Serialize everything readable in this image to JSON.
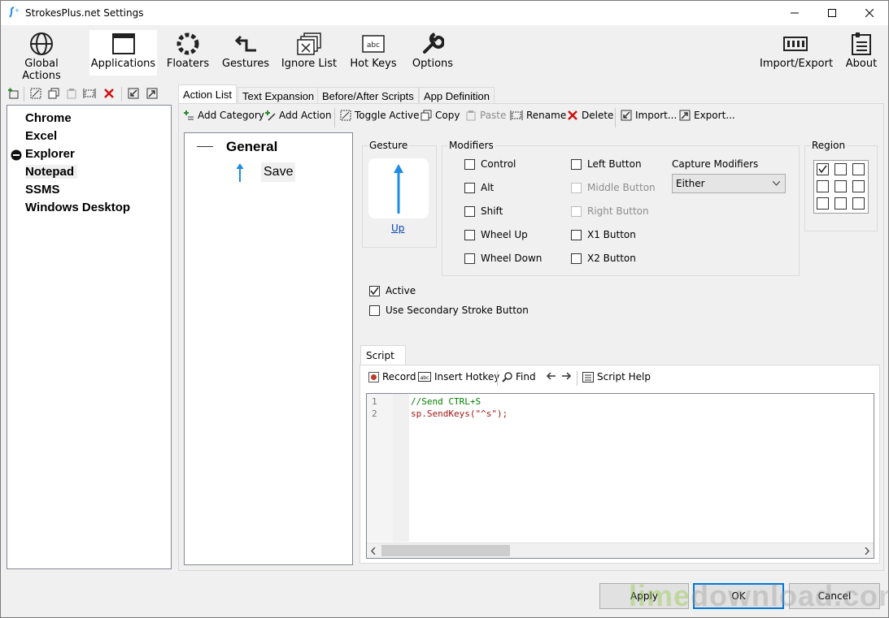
{
  "window": {
    "title": "StrokesPlus.net Settings"
  },
  "ribbon": {
    "items": [
      {
        "label": "Global Actions",
        "icon": "globe-icon"
      },
      {
        "label": "Applications",
        "icon": "window-icon",
        "active": true
      },
      {
        "label": "Floaters",
        "icon": "floater-ring-icon"
      },
      {
        "label": "Gestures",
        "icon": "gesture-arrow-icon"
      },
      {
        "label": "Ignore List",
        "icon": "ignore-windows-icon"
      },
      {
        "label": "Hot Keys",
        "icon": "keyboard-key-icon"
      },
      {
        "label": "Options",
        "icon": "wrench-icon"
      }
    ],
    "right_items": [
      {
        "label": "Import/Export",
        "icon": "import-export-icon"
      },
      {
        "label": "About",
        "icon": "about-icon"
      }
    ]
  },
  "app_list": {
    "items": [
      {
        "label": "Chrome"
      },
      {
        "label": "Excel"
      },
      {
        "label": "Explorer",
        "disabled_icon": true
      },
      {
        "label": "Notepad",
        "selected": true
      },
      {
        "label": "SSMS"
      },
      {
        "label": "Windows Desktop"
      }
    ]
  },
  "tabs": [
    "Action List",
    "Text Expansion",
    "Before/After Scripts",
    "App Definition"
  ],
  "action_toolbar": {
    "add_category": "Add Category",
    "add_action": "Add Action",
    "toggle_active": "Toggle Active",
    "copy": "Copy",
    "paste": "Paste",
    "rename": "Rename",
    "delete": "Delete",
    "import": "Import...",
    "export": "Export..."
  },
  "tree": {
    "category": "General",
    "action": "Save"
  },
  "gesture": {
    "title": "Gesture",
    "name": "Up"
  },
  "modifiers": {
    "title": "Modifiers",
    "col1": [
      "Control",
      "Alt",
      "Shift",
      "Wheel Up",
      "Wheel Down"
    ],
    "col2": [
      "Left Button",
      "Middle Button",
      "Right Button",
      "X1 Button",
      "X2 Button"
    ],
    "capture_label": "Capture Modifiers",
    "capture_value": "Either"
  },
  "region": {
    "title": "Region",
    "checked_cell": 0
  },
  "options": {
    "active": "Active",
    "active_checked": true,
    "secondary": "Use Secondary Stroke Button"
  },
  "script": {
    "tab": "Script",
    "toolbar": {
      "record": "Record",
      "insert_hotkey": "Insert Hotkey",
      "find": "Find",
      "help": "Script Help"
    },
    "lines": [
      {
        "num": "1",
        "text": "//Send CTRL+S"
      },
      {
        "num": "2",
        "text": "sp.SendKeys(\"^s\");"
      }
    ]
  },
  "buttons": {
    "apply": "Apply",
    "ok": "OK",
    "cancel": "Cancel"
  },
  "watermark": {
    "lime": "lime",
    "rest": "download.com"
  },
  "colors": {
    "accent": "#0078d7",
    "arrow": "#1e8ce6",
    "comment": "#008000",
    "code": "#a31515"
  }
}
